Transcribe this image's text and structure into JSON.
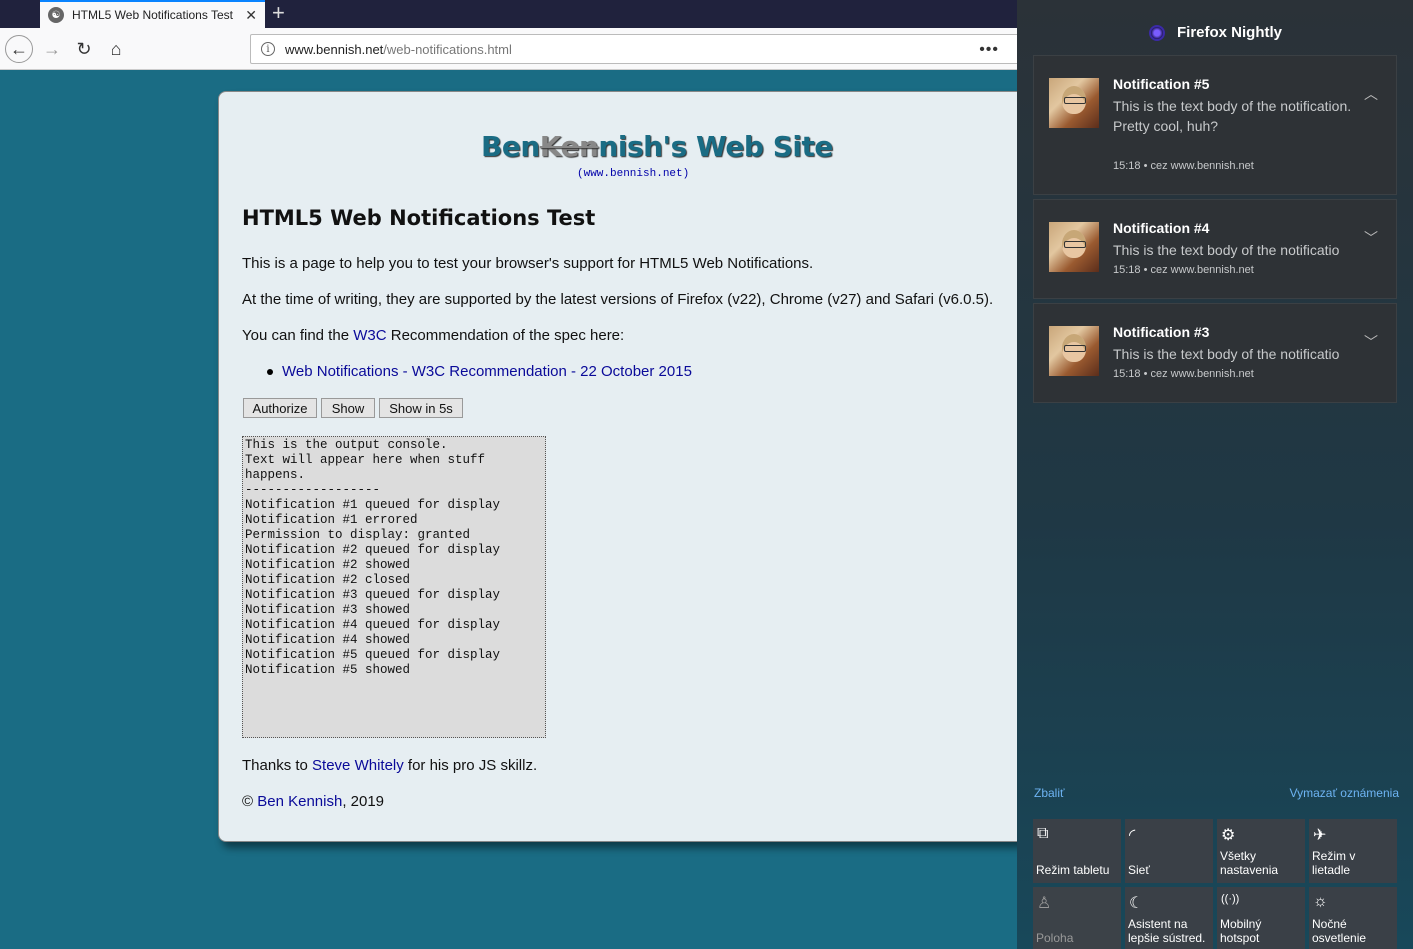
{
  "browser": {
    "tab_title": "HTML5 Web Notifications Test",
    "new_tab_icon": "+",
    "close_icon": "✕",
    "url_domain": "www.bennish.net",
    "url_path": "/web-notifications.html",
    "overflow_icon": "•••"
  },
  "page": {
    "site_title_pre": "Ben",
    "site_title_strike": "Ken",
    "site_title_post": "nish's Web Site",
    "site_url": "(www.bennish.net)",
    "heading": "HTML5 Web Notifications Test",
    "p1": "This is a page to help you to test your browser's support for HTML5 Web Notifications.",
    "p2": "At the time of writing, they are supported by the latest versions of Firefox (v22), Chrome (v27) and Safari (v6.0.5).",
    "p3_pre": "You can find the ",
    "p3_link": "W3C",
    "p3_post": " Recommendation of the spec here:",
    "spec_link": "Web Notifications - W3C Recommendation - 22 October 2015",
    "buttons": {
      "authorize": "Authorize",
      "show": "Show",
      "show_delay": "Show in 5s"
    },
    "console": "This is the output console.\nText will appear here when stuff\nhappens.\n------------------\nNotification #1 queued for display\nNotification #1 errored\nPermission to display: granted\nNotification #2 queued for display\nNotification #2 showed\nNotification #2 closed\nNotification #3 queued for display\nNotification #3 showed\nNotification #4 queued for display\nNotification #4 showed\nNotification #5 queued for display\nNotification #5 showed",
    "p4_pre": "Thanks to ",
    "p4_link": "Steve Whitely",
    "p4_post": " for his pro JS skillz.",
    "p5_pre": "© ",
    "p5_link": "Ben Kennish",
    "p5_post": ", 2019"
  },
  "action_center": {
    "app_name": "Firefox Nightly",
    "notifications": [
      {
        "title": "Notification #5",
        "body": "This is the text body of the notification.\nPretty cool, huh?",
        "meta": "15:18 • cez www.bennish.net",
        "chevron": "︿"
      },
      {
        "title": "Notification #4",
        "body": "This is the text body of the notificatio",
        "meta": "15:18 • cez www.bennish.net",
        "chevron": "﹀"
      },
      {
        "title": "Notification #3",
        "body": "This is the text body of the notificatio",
        "meta": "15:18 • cez www.bennish.net",
        "chevron": "﹀"
      }
    ],
    "collapse": "Zbaliť",
    "clear_all": "Vymazať oznámenia",
    "tiles": [
      {
        "label": "Režim tabletu",
        "icon": "⧉"
      },
      {
        "label": "Sieť",
        "icon": "◜"
      },
      {
        "label": "Všetky nastavenia",
        "icon": "⚙"
      },
      {
        "label": "Režim v lietadle",
        "icon": "✈"
      },
      {
        "label": "Poloha",
        "icon": "♙"
      },
      {
        "label": "Asistent na lepšie sústred.",
        "icon": "☾"
      },
      {
        "label": "Mobilný hotspot",
        "icon": "((·))"
      },
      {
        "label": "Nočné osvetlenie",
        "icon": "☼"
      }
    ]
  }
}
